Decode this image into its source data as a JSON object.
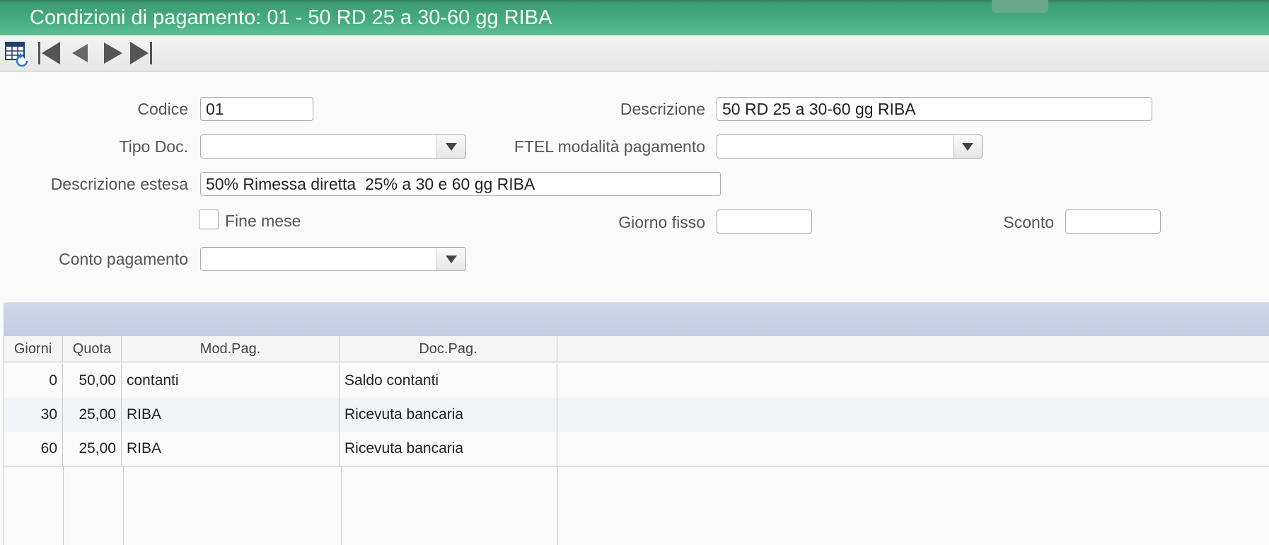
{
  "window": {
    "title": "Condizioni di pagamento: 01 - 50 RD 25 a 30-60 gg RIBA"
  },
  "toolbar": {
    "buttons": [
      "table-list-icon",
      "first-record-icon",
      "previous-record-icon",
      "next-record-icon",
      "last-record-icon"
    ]
  },
  "form": {
    "codice": {
      "label": "Codice",
      "value": "01"
    },
    "descrizione": {
      "label": "Descrizione",
      "value": "50 RD 25 a 30-60 gg RIBA"
    },
    "tipo_doc": {
      "label": "Tipo Doc.",
      "value": ""
    },
    "ftel_modalita": {
      "label": "FTEL modalità pagamento",
      "value": ""
    },
    "descrizione_estesa": {
      "label": "Descrizione estesa",
      "value": "50% Rimessa diretta  25% a 30 e 60 gg RIBA"
    },
    "fine_mese": {
      "label": "Fine mese",
      "checked": false
    },
    "giorno_fisso": {
      "label": "Giorno fisso",
      "value": ""
    },
    "sconto": {
      "label": "Sconto",
      "value": ""
    },
    "conto_pagamento": {
      "label": "Conto pagamento",
      "value": ""
    }
  },
  "grid": {
    "columns": [
      "Giorni",
      "Quota",
      "Mod.Pag.",
      "Doc.Pag."
    ],
    "rows": [
      {
        "giorni": "0",
        "quota": "50,00",
        "mod_pag": "contanti",
        "doc_pag": "Saldo contanti"
      },
      {
        "giorni": "30",
        "quota": "25,00",
        "mod_pag": "RIBA",
        "doc_pag": "Ricevuta bancaria"
      },
      {
        "giorni": "60",
        "quota": "25,00",
        "mod_pag": "RIBA",
        "doc_pag": "Ricevuta bancaria"
      }
    ]
  },
  "colors": {
    "titlebar": "#46ad80",
    "grid_header_band": "#c6d2e6",
    "row_alt": "#f2f3f7"
  }
}
